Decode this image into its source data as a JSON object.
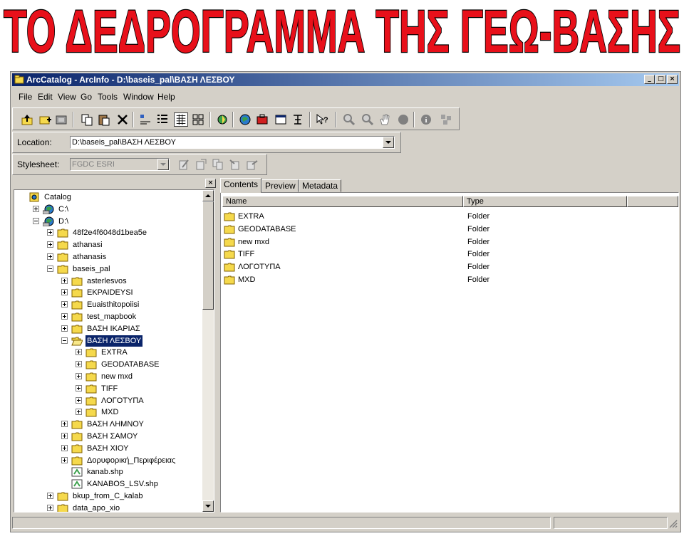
{
  "banner": {
    "text": "ΤΟ ΔΕΔΡΟΓΡΑΜΜΑ ΤΗΣ ΓΕΩ-ΒΑΣΗΣ",
    "color": "#e8101a"
  },
  "window": {
    "title": "ArcCatalog - ArcInfo - D:\\baseis_pal\\ΒΑΣΗ ΛΕΣΒΟΥ",
    "title_bar_color": "#0a246a"
  },
  "menu": [
    "File",
    "Edit",
    "View",
    "Go",
    "Tools",
    "Window",
    "Help"
  ],
  "location": {
    "label": "Location:",
    "value": "D:\\baseis_pal\\ΒΑΣΗ ΛΕΣΒΟΥ"
  },
  "stylesheet": {
    "label": "Stylesheet:",
    "value": "FGDC ESRI"
  },
  "tabs": [
    "Contents",
    "Preview",
    "Metadata"
  ],
  "tree": [
    {
      "label": "Catalog",
      "level": 0,
      "icon": "catalog-icon",
      "expander": "none"
    },
    {
      "label": "C:\\",
      "level": 1,
      "icon": "drive-icon",
      "expander": "plus"
    },
    {
      "label": "D:\\",
      "level": 1,
      "icon": "drive-icon",
      "expander": "minus"
    },
    {
      "label": "48f2e4f6048d1bea5e",
      "level": 2,
      "icon": "folder-icon",
      "expander": "plus"
    },
    {
      "label": "athanasi",
      "level": 2,
      "icon": "folder-icon",
      "expander": "plus"
    },
    {
      "label": "athanasis",
      "level": 2,
      "icon": "folder-icon",
      "expander": "plus"
    },
    {
      "label": "baseis_pal",
      "level": 2,
      "icon": "folder-icon",
      "expander": "minus"
    },
    {
      "label": "asterlesvos",
      "level": 3,
      "icon": "folder-icon",
      "expander": "plus"
    },
    {
      "label": "EKPAIDEYSI",
      "level": 3,
      "icon": "folder-icon",
      "expander": "plus"
    },
    {
      "label": "Euaisthitopoiisi",
      "level": 3,
      "icon": "folder-icon",
      "expander": "plus"
    },
    {
      "label": "test_mapbook",
      "level": 3,
      "icon": "folder-icon",
      "expander": "plus"
    },
    {
      "label": "ΒΑΣΗ ΙΚΑΡΙΑΣ",
      "level": 3,
      "icon": "folder-icon",
      "expander": "plus"
    },
    {
      "label": "ΒΑΣΗ ΛΕΣΒΟΥ",
      "level": 3,
      "icon": "open-folder-icon",
      "expander": "minus",
      "selected": true
    },
    {
      "label": "EXTRA",
      "level": 4,
      "icon": "folder-icon",
      "expander": "plus"
    },
    {
      "label": "GEODATABASE",
      "level": 4,
      "icon": "folder-icon",
      "expander": "plus"
    },
    {
      "label": "new mxd",
      "level": 4,
      "icon": "folder-icon",
      "expander": "plus"
    },
    {
      "label": "TIFF",
      "level": 4,
      "icon": "folder-icon",
      "expander": "plus"
    },
    {
      "label": "ΛΟΓΟΤΥΠΑ",
      "level": 4,
      "icon": "folder-icon",
      "expander": "plus"
    },
    {
      "label": "MXD",
      "level": 4,
      "icon": "folder-icon",
      "expander": "plus"
    },
    {
      "label": "ΒΑΣΗ ΛΗΜΝΟΥ",
      "level": 3,
      "icon": "folder-icon",
      "expander": "plus"
    },
    {
      "label": "ΒΑΣΗ ΣΑΜΟΥ",
      "level": 3,
      "icon": "folder-icon",
      "expander": "plus"
    },
    {
      "label": "ΒΑΣΗ ΧΙΟΥ",
      "level": 3,
      "icon": "folder-icon",
      "expander": "plus"
    },
    {
      "label": "Δορυφορική_Περιφέρειας",
      "level": 3,
      "icon": "folder-icon",
      "expander": "plus"
    },
    {
      "label": "kanab.shp",
      "level": 3,
      "icon": "shapefile-icon",
      "expander": "none"
    },
    {
      "label": "KANABOS_LSV.shp",
      "level": 3,
      "icon": "shapefile-icon",
      "expander": "none"
    },
    {
      "label": "bkup_from_C_kalab",
      "level": 2,
      "icon": "folder-icon",
      "expander": "plus"
    },
    {
      "label": "data_apo_xio",
      "level": 2,
      "icon": "folder-icon",
      "expander": "plus"
    }
  ],
  "contents": {
    "columns": [
      "Name",
      "Type"
    ],
    "rows": [
      {
        "name": "EXTRA",
        "type": "Folder"
      },
      {
        "name": "GEODATABASE",
        "type": "Folder"
      },
      {
        "name": "new mxd",
        "type": "Folder"
      },
      {
        "name": "TIFF",
        "type": "Folder"
      },
      {
        "name": "ΛΟΓΟΤΥΠΑ",
        "type": "Folder"
      },
      {
        "name": "MXD",
        "type": "Folder"
      }
    ]
  },
  "toolbar_icons": [
    "up-one-level-icon",
    "connect-folder-icon",
    "disconnect-folder-icon",
    "copy-icon",
    "paste-icon",
    "delete-icon",
    "large-icons-icon",
    "list-icon",
    "details-icon",
    "thumbnails-icon",
    "launch-arcmap-icon",
    "arctoolbox-icon",
    "arctools-icon",
    "command-line-icon",
    "model-builder-icon",
    "whats-this-icon",
    "zoom-in-icon",
    "zoom-out-icon",
    "pan-icon",
    "full-extent-icon",
    "identify-icon",
    "create-thumbnail-icon"
  ],
  "stylesheet_icons": [
    "edit-metadata-icon",
    "metadata-properties-icon",
    "create-metadata-icon",
    "import-metadata-icon",
    "export-metadata-icon"
  ],
  "colors": {
    "folder": "#f5d94c",
    "selection": "#0a246a",
    "chrome": "#d4d0c8"
  }
}
